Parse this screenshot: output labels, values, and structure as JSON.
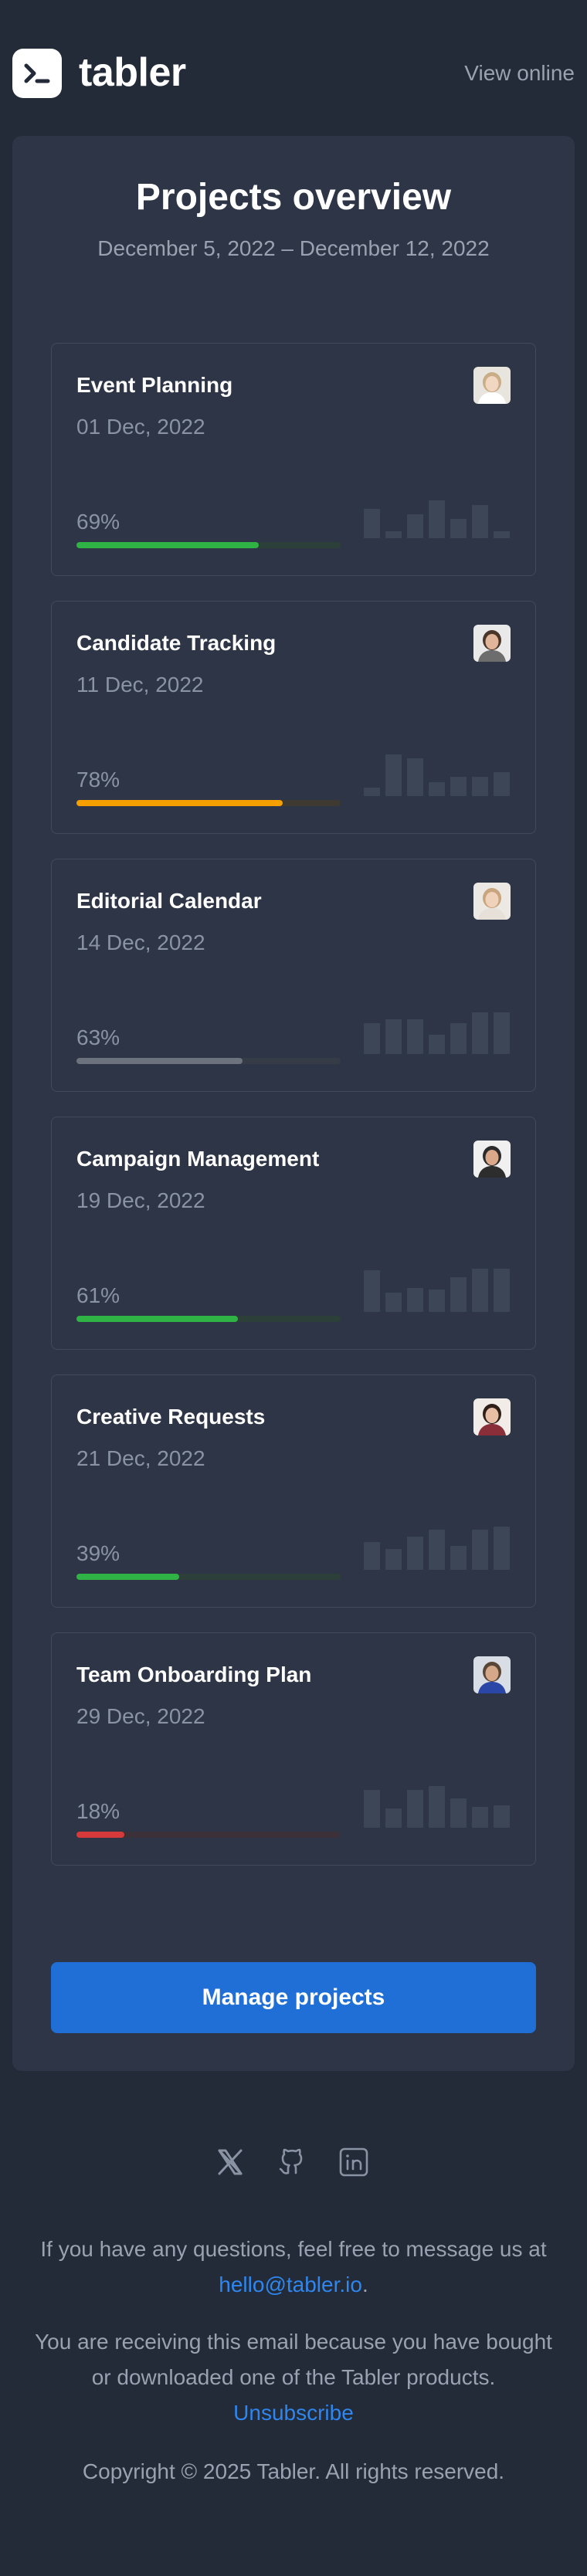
{
  "header": {
    "brand": "tabler",
    "view_online": "View online"
  },
  "main": {
    "title": "Projects overview",
    "date_range": "December 5, 2022 – December 12, 2022",
    "projects": [
      {
        "name": "Event Planning",
        "date": "01 Dec, 2022",
        "progress": 69,
        "progress_label": "69%",
        "color": "#2fb344",
        "track": "#2c3f39",
        "sparkline": [
          17,
          4,
          14,
          22,
          11,
          19,
          4
        ]
      },
      {
        "name": "Candidate Tracking",
        "date": "11 Dec, 2022",
        "progress": 78,
        "progress_label": "78%",
        "color": "#f59f00",
        "track": "#3f3a31",
        "sparkline": [
          5,
          24,
          22,
          8,
          11,
          11,
          14
        ]
      },
      {
        "name": "Editorial Calendar",
        "date": "14 Dec, 2022",
        "progress": 63,
        "progress_label": "63%",
        "color": "#6d737e",
        "track": "#363c47",
        "sparkline": [
          18,
          20,
          20,
          11,
          18,
          24,
          24
        ]
      },
      {
        "name": "Campaign Management",
        "date": "19 Dec, 2022",
        "progress": 61,
        "progress_label": "61%",
        "color": "#2fb344",
        "track": "#2c3f39",
        "sparkline": [
          24,
          11,
          14,
          13,
          20,
          25,
          25
        ]
      },
      {
        "name": "Creative Requests",
        "date": "21 Dec, 2022",
        "progress": 39,
        "progress_label": "39%",
        "color": "#2fb344",
        "track": "#2c3f39",
        "sparkline": [
          16,
          12,
          19,
          23,
          14,
          23,
          25
        ]
      },
      {
        "name": "Team Onboarding Plan",
        "date": "29 Dec, 2022",
        "progress": 18,
        "progress_label": "18%",
        "color": "#d63939",
        "track": "#3c3139",
        "sparkline": [
          22,
          11,
          22,
          24,
          17,
          12,
          13
        ]
      }
    ],
    "button": "Manage projects"
  },
  "footer": {
    "social_icons": [
      "x-icon",
      "github-icon",
      "linkedin-icon"
    ],
    "questions_text": "If you have any questions, feel free to message us at",
    "email": "hello@tabler.io",
    "email_suffix": ".",
    "receiving_line1": "You are receiving this email because you have bought",
    "receiving_line2": "or downloaded one of the Tabler products.",
    "unsubscribe": "Unsubscribe",
    "copyright": "Copyright © 2025 Tabler. All rights reserved."
  }
}
